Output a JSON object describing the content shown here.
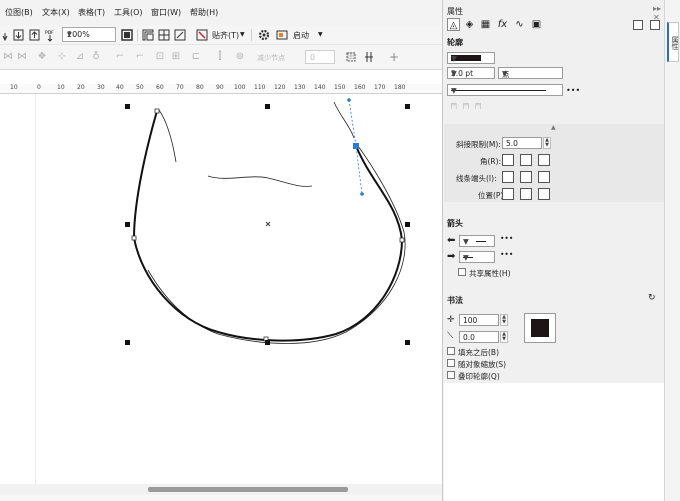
{
  "menu": {
    "items": [
      "位图(B)",
      "文本(X)",
      "表格(T)",
      "工具(O)",
      "窗口(W)",
      "帮助(H)"
    ]
  },
  "toolbar": {
    "zoom": "200%",
    "snap_label": "贴齐(T)",
    "launch_label": "启动"
  },
  "propbar": {
    "reduce_nodes_label": "减少节点",
    "node_value": "0"
  },
  "ruler": {
    "labels": [
      "10",
      "0",
      "10",
      "20",
      "30",
      "40",
      "50",
      "60",
      "70",
      "80",
      "90",
      "100",
      "110",
      "120",
      "130",
      "140",
      "150",
      "160",
      "170",
      "180"
    ]
  },
  "docker": {
    "title": "属性",
    "outline_section": "轮廓",
    "width_value": "2.0 pt",
    "unit_value": "点",
    "more": "•••",
    "miter_label": "斜接限制(M):",
    "miter_value": "5.0",
    "corner_label": "角(R):",
    "line_caps_label": "线条端头(I):",
    "position_label": "位置(P):",
    "arrows_section": "箭头",
    "share_attributes_label": "共享属性(H)",
    "calligraphy_section": "书法",
    "stretch_value": "100",
    "angle_value": "0.0",
    "fill_behind_label": "填充之后(B)",
    "scale_with_object_label": "随对象缩放(S)",
    "overprint_label": "叠印轮廓(Q)",
    "outline_color": "#1e1616"
  },
  "side_tab": {
    "label": "属性"
  }
}
